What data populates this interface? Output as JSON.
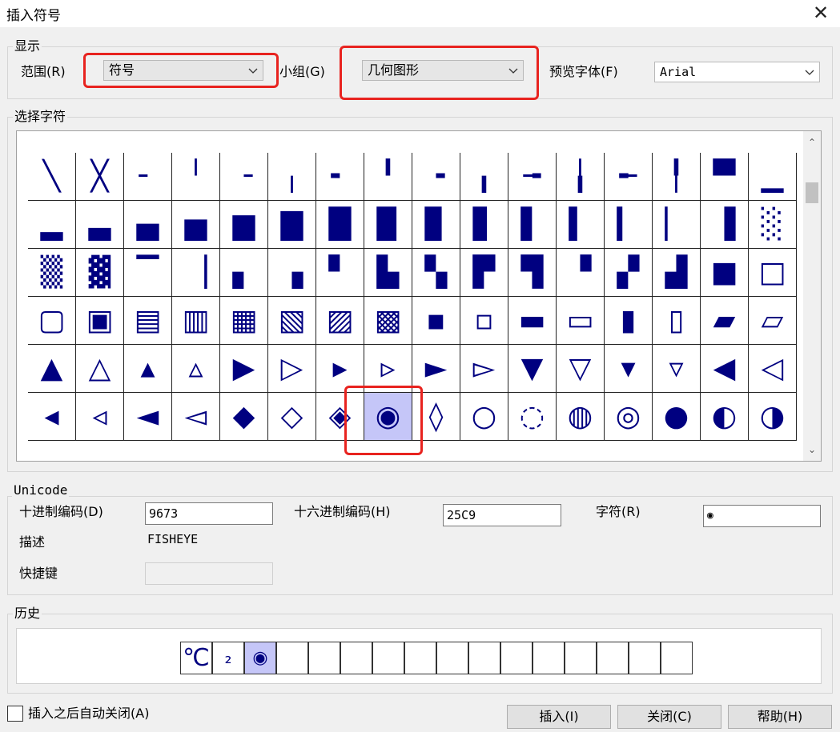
{
  "window": {
    "title": "插入符号",
    "close_icon": "✕"
  },
  "display_group": {
    "label": "显示",
    "range_label": "范围(R)",
    "range_value": "符号",
    "subset_label": "小组(G)",
    "subset_value": "几何图形",
    "font_label": "预览字体(F)",
    "font_value": "Arial"
  },
  "grid": {
    "label": "选择字符",
    "rows": [
      [
        "╲",
        "╳",
        "╴",
        "╵",
        "╶",
        "╷",
        "╸",
        "╹",
        "╺",
        "╻",
        "╼",
        "╽",
        "╾",
        "╿",
        "▀",
        "▁"
      ],
      [
        "▂",
        "▃",
        "▄",
        "▅",
        "▆",
        "▇",
        "█",
        "▉",
        "▊",
        "▋",
        "▌",
        "▍",
        "▎",
        "▏",
        "▐",
        "░"
      ],
      [
        "▒",
        "▓",
        "▔",
        "▕",
        "▖",
        "▗",
        "▘",
        "▙",
        "▚",
        "▛",
        "▜",
        "▝",
        "▞",
        "▟",
        "■",
        "□"
      ],
      [
        "▢",
        "▣",
        "▤",
        "▥",
        "▦",
        "▧",
        "▨",
        "▩",
        "▪",
        "▫",
        "▬",
        "▭",
        "▮",
        "▯",
        "▰",
        "▱"
      ],
      [
        "▲",
        "△",
        "▴",
        "▵",
        "▶",
        "▷",
        "▸",
        "▹",
        "►",
        "▻",
        "▼",
        "▽",
        "▾",
        "▿",
        "◀",
        "◁"
      ],
      [
        "◂",
        "◃",
        "◄",
        "◅",
        "◆",
        "◇",
        "◈",
        "◉",
        "◊",
        "○",
        "◌",
        "◍",
        "◎",
        "●",
        "◐",
        "◑"
      ]
    ],
    "selected": {
      "row": 5,
      "col": 7
    }
  },
  "unicode_group": {
    "label": "Unicode",
    "decimal_label": "十进制编码(D)",
    "decimal_value": "9673",
    "hex_label": "十六进制编码(H)",
    "hex_value": "25C9",
    "char_label": "字符(R)",
    "char_value": "◉",
    "desc_label": "描述",
    "desc_value": "FISHEYE",
    "shortcut_label": "快捷键",
    "shortcut_value": ""
  },
  "history": {
    "label": "历史",
    "items": [
      "℃",
      "₂",
      "◉",
      "",
      "",
      "",
      "",
      "",
      "",
      "",
      "",
      "",
      "",
      "",
      "",
      ""
    ],
    "selected": 2
  },
  "footer": {
    "autoclose_label": "插入之后自动关闭(A)",
    "autoclose_checked": false,
    "insert_label": "插入(I)",
    "close_label": "关闭(C)",
    "help_label": "帮助(H)"
  },
  "colors": {
    "glyph": "#000080",
    "selection": "#c5c6f8",
    "highlight": "#e8231f"
  }
}
